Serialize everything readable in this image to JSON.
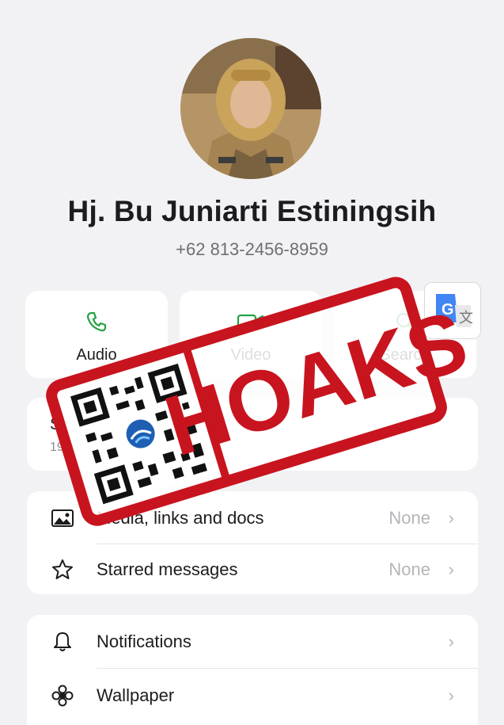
{
  "contact": {
    "name": "Hj. Bu Juniarti Estiningsih",
    "phone": "+62 813-2456-8959"
  },
  "actions": [
    {
      "label": "Audio",
      "icon": "phone-icon"
    },
    {
      "label": "Video",
      "icon": "video-camera-icon"
    },
    {
      "label": "Search",
      "icon": "search-icon"
    }
  ],
  "translate_badge": {
    "letter": "G",
    "icon": "google-translate-icon"
  },
  "status": {
    "title": "S",
    "date": "19"
  },
  "media_section": [
    {
      "label": "Media, links and docs",
      "value": "None",
      "icon": "image-icon"
    },
    {
      "label": "Starred messages",
      "value": "None",
      "icon": "star-icon"
    }
  ],
  "settings_section": [
    {
      "label": "Notifications",
      "icon": "bell-icon"
    },
    {
      "label": "Wallpaper",
      "icon": "flower-icon"
    }
  ],
  "stamp": {
    "text": "HOAKS",
    "color": "#c8141e"
  },
  "colors": {
    "accent": "#25a244",
    "background": "#f2f2f5",
    "stamp": "#c8141e"
  }
}
